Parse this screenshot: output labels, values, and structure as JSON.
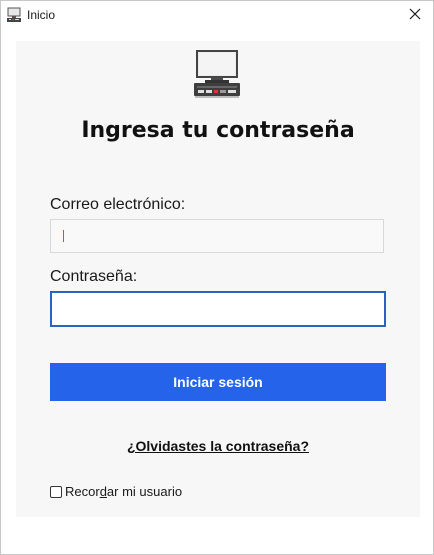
{
  "window": {
    "title": "Inicio",
    "app_icon": "computer-icon",
    "close_icon": "close-icon"
  },
  "login": {
    "logo_icon": "computer-icon",
    "heading": "Ingresa tu contraseña",
    "email_label": "Correo electrónico:",
    "email_value": "",
    "password_label": "Contraseña:",
    "password_value": "",
    "submit_label": "Iniciar sesión",
    "forgot_link": "¿Olvidastes la contraseña?",
    "remember_label_pre": "Recor",
    "remember_label_accel": "d",
    "remember_label_post": "ar mi usuario",
    "remember_checked": false
  },
  "colors": {
    "accent": "#2563eb",
    "focus_border": "#2a62c4",
    "panel_bg": "#f7f7f7"
  }
}
